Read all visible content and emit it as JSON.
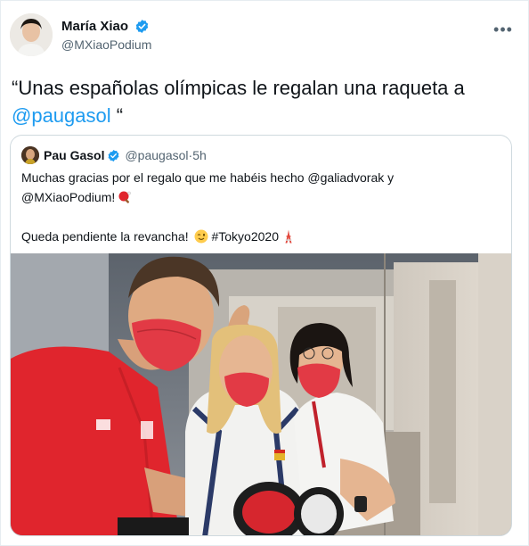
{
  "tweet": {
    "author_name": "María Xiao",
    "author_handle": "@MXiaoPodium",
    "text_before": "“Unas españolas olímpicas le regalan una raqueta a ",
    "mention": "@paugasol",
    "text_after": " “",
    "more_icon": "more-horizontal-icon"
  },
  "quoted_tweet": {
    "author_name": "Pau Gasol",
    "author_handle": "@paugasol",
    "separator": " · ",
    "time": "5h",
    "line1": "Muchas gracias por el regalo que me habéis hecho @galiadvorak y",
    "line2": "@MXiaoPodium!",
    "line3_text": "Queda pendiente la revancha!",
    "hashtag": "#Tokyo2020",
    "emojis": [
      "ping-pong-paddle-icon",
      "winking-face-icon",
      "tokyo-tower-icon"
    ]
  },
  "colors": {
    "link": "#1d9bf0",
    "verified": "#1d9bf0",
    "secondary_text": "#536471",
    "border": "#cfd9de"
  }
}
